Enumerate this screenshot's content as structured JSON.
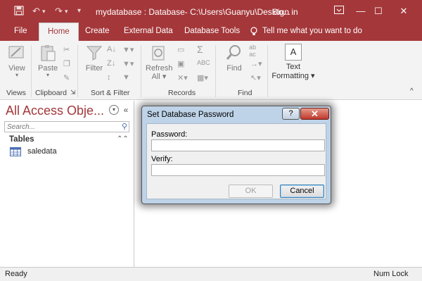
{
  "window": {
    "title": "mydatabase : Database- C:\\Users\\Guanyu\\Deskto...",
    "sign_in": "Sign in",
    "minimize_icon": "minimize-icon",
    "restore_icon": "restore-icon",
    "close_icon": "close-icon"
  },
  "quick_access": {
    "save_icon": "save-icon",
    "undo_icon": "undo-icon",
    "redo_icon": "redo-icon",
    "customize_icon": "customize-qat-icon"
  },
  "tabs": [
    {
      "label": "File"
    },
    {
      "label": "Home",
      "active": true
    },
    {
      "label": "Create"
    },
    {
      "label": "External Data"
    },
    {
      "label": "Database Tools"
    },
    {
      "label": "Tell me what you want to do"
    }
  ],
  "ribbon": {
    "view_label": "View",
    "paste_label": "Paste",
    "filter_label": "Filter",
    "refresh_label": "Refresh",
    "refresh_all_label": "All",
    "find_label": "Find",
    "text_formatting_label": "Text",
    "text_formatting_label2": "Formatting",
    "text_formatting_glyph": "A",
    "groups": [
      "Views",
      "Clipboard",
      "Sort & Filter",
      "Records",
      "Find"
    ]
  },
  "nav_pane": {
    "title": "All Access Obje...",
    "search_placeholder": "Search...",
    "group_header": "Tables",
    "items": [
      {
        "label": "saledata"
      }
    ]
  },
  "status_bar": {
    "left": "Ready",
    "right": "Num Lock"
  },
  "dialog": {
    "title": "Set Database Password",
    "help_glyph": "?",
    "close_glyph": "✕",
    "password_label": "Password:",
    "password_value": "",
    "verify_label": "Verify:",
    "verify_value": "",
    "ok_label": "OK",
    "cancel_label": "Cancel"
  },
  "colors": {
    "accent": "#a4373a",
    "dialog_frame": "#bed3e8"
  }
}
